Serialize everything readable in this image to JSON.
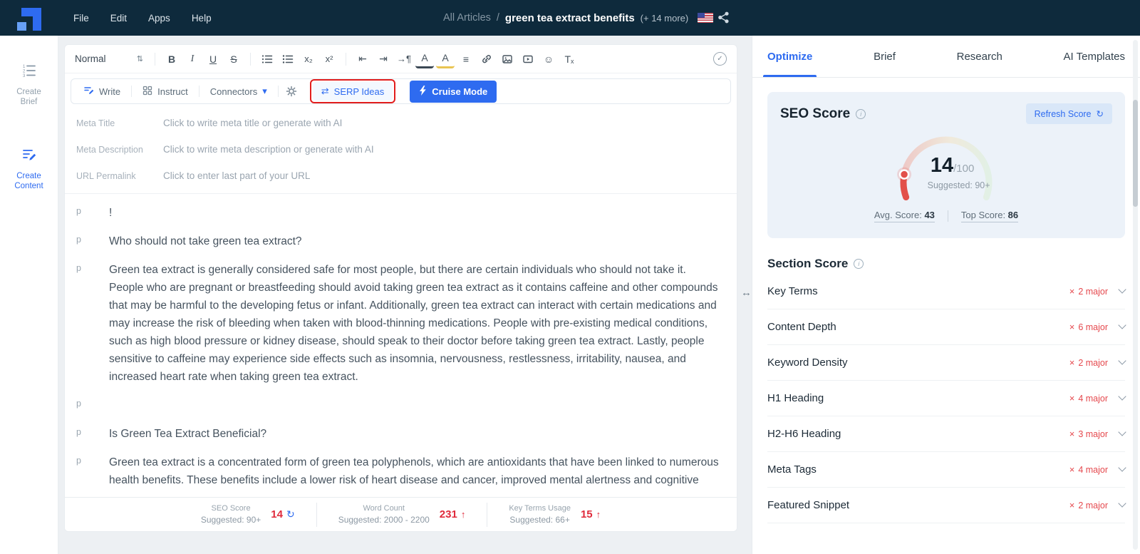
{
  "colors": {
    "navy": "#0e2a3c",
    "accent": "#2e6bf0",
    "badge_red": "#e5484d",
    "value_red": "#e02b3c",
    "annotation_red": "#e21d1d",
    "gauge_red": "#e2504a",
    "score_card_bg": "#ecf2f9"
  },
  "topbar": {
    "menus": [
      "File",
      "Edit",
      "Apps",
      "Help"
    ],
    "breadcrumb": {
      "section": "All Articles",
      "separator": "/",
      "title": "green tea extract benefits",
      "extra": "(+ 14 more)"
    }
  },
  "sidebar": {
    "items": [
      {
        "label": "Create Brief"
      },
      {
        "label": "Create Content"
      }
    ]
  },
  "editor": {
    "style_name": "Normal",
    "modebar": {
      "write": "Write",
      "instruct": "Instruct",
      "connectors": "Connectors",
      "serp_ideas": "SERP Ideas",
      "cruise_mode": "Cruise Mode"
    },
    "meta_fields": [
      {
        "label": "Meta Title",
        "placeholder": "Click to write meta title or generate with AI"
      },
      {
        "label": "Meta Description",
        "placeholder": "Click to write meta description or generate with AI"
      },
      {
        "label": "URL Permalink",
        "placeholder": "Click to enter last part of your URL"
      }
    ],
    "paragraphs": [
      {
        "marker": "p",
        "text": "!"
      },
      {
        "marker": "p",
        "text": "Who should not take green tea extract?"
      },
      {
        "marker": "p",
        "text": "Green tea extract is generally considered safe for most people, but there are certain individuals who should not take it. People who are pregnant or breastfeeding should avoid taking green tea extract as it contains caffeine and other compounds that may be harmful to the developing fetus or infant. Additionally, green tea extract can interact with certain medications and may increase the risk of bleeding when taken with blood-thinning medications. People with pre-existing medical conditions, such as high blood pressure or kidney disease, should speak to their doctor before taking green tea extract. Lastly, people sensitive to caffeine may experience side effects such as insomnia, nervousness, restlessness, irritability, nausea, and increased heart rate when taking green tea extract."
      },
      {
        "marker": "p",
        "text": ""
      },
      {
        "marker": "p",
        "text": "Is Green Tea Extract Beneficial?"
      },
      {
        "marker": "p",
        "text": "Green tea extract is a concentrated form of green tea polyphenols, which are antioxidants that have been linked to numerous health benefits. These benefits include a lower risk of heart disease and cancer, improved mental alertness and cognitive"
      }
    ],
    "statusbar": {
      "groups": [
        {
          "label": "SEO Score",
          "suggested": "Suggested: 90+",
          "value": "14"
        },
        {
          "label": "Word Count",
          "suggested": "Suggested: 2000 - 2200",
          "value": "231",
          "arrow": "↑"
        },
        {
          "label": "Key Terms Usage",
          "suggested": "Suggested: 66+",
          "value": "15",
          "arrow": "↑"
        }
      ]
    }
  },
  "panel": {
    "tabs": [
      {
        "label": "Optimize"
      },
      {
        "label": "Brief"
      },
      {
        "label": "Research"
      },
      {
        "label": "AI Templates"
      }
    ],
    "seo_score": {
      "title": "SEO Score",
      "refresh_button": "Refresh Score",
      "score": "14",
      "max": "/100",
      "suggested": "Suggested: 90+",
      "avg_label": "Avg. Score: ",
      "avg_value": "43",
      "top_label": "Top Score: ",
      "top_value": "86"
    },
    "section_score": {
      "title": "Section Score",
      "x_mark": "×",
      "rows": [
        {
          "label": "Key Terms",
          "badge": "2 major"
        },
        {
          "label": "Content Depth",
          "badge": "6 major"
        },
        {
          "label": "Keyword Density",
          "badge": "2 major"
        },
        {
          "label": "H1 Heading",
          "badge": "4 major"
        },
        {
          "label": "H2-H6 Heading",
          "badge": "3 major"
        },
        {
          "label": "Meta Tags",
          "badge": "4 major"
        },
        {
          "label": "Featured Snippet",
          "badge": "2 major"
        }
      ]
    }
  },
  "icons": {
    "style_updown": "⇅",
    "bold": "B",
    "italic": "I",
    "underline": "U",
    "strikethrough": "S",
    "subscript": "x₂",
    "superscript": "x²",
    "outdent": "⇤",
    "indent": "⇥",
    "paragraph_dir": "→¶",
    "font_color": "A",
    "highlight": "A",
    "align": "≡",
    "emoji": "☺",
    "clear_t": "T",
    "clear_x": "x",
    "check": "✓",
    "shuffle": "⇄",
    "dropdown": "▾",
    "refresh": "↻",
    "resize": "↔",
    "info": "i"
  }
}
